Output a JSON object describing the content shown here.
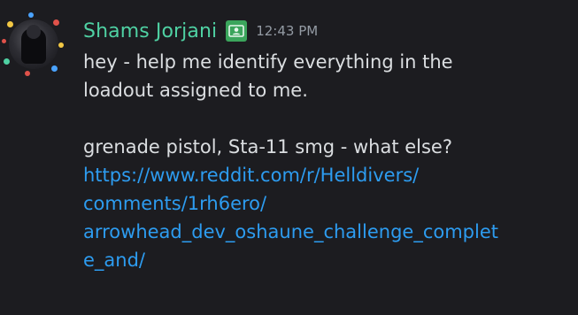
{
  "message": {
    "author": "Shams Jorjani",
    "author_color": "#4fd1a3",
    "role_icon": "id-card-icon",
    "timestamp": "12:43 PM",
    "text_lines": [
      "hey - help me identify everything in the",
      "loadout assigned to me.",
      "",
      "grenade pistol, Sta-11 smg - what else?"
    ],
    "link_lines": [
      "https://www.reddit.com/r/Helldivers/",
      "comments/1rh6ero/",
      "arrowhead_dev_oshaune_challenge_complet",
      "e_and/"
    ],
    "link_color": "#2d9cf0"
  }
}
